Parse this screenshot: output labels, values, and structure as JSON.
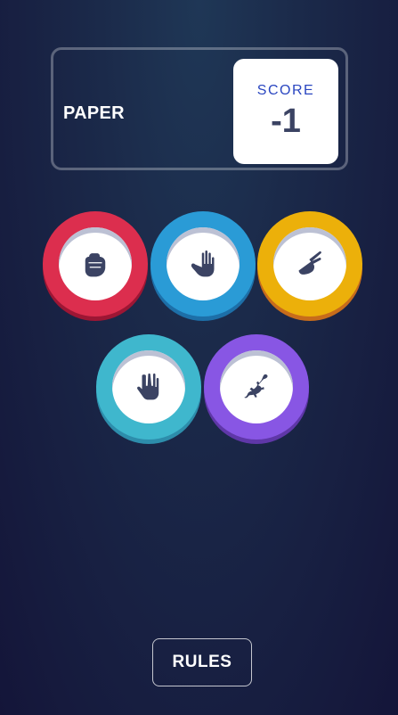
{
  "header": {
    "title": "PAPER",
    "score_label": "SCORE",
    "score_value": "-1"
  },
  "tokens": [
    {
      "name": "rock",
      "icon": "fist-icon",
      "color": "#dc2e4e"
    },
    {
      "name": "paper",
      "icon": "open-hand-icon",
      "color": "#2a9bd6"
    },
    {
      "name": "scissors",
      "icon": "scissors-hand-icon",
      "color": "#ecb00a"
    },
    {
      "name": "spock",
      "icon": "spock-hand-icon",
      "color": "#3fb7cd"
    },
    {
      "name": "lizard",
      "icon": "lizard-icon",
      "color": "#8856e4"
    }
  ],
  "footer": {
    "rules_label": "RULES"
  }
}
